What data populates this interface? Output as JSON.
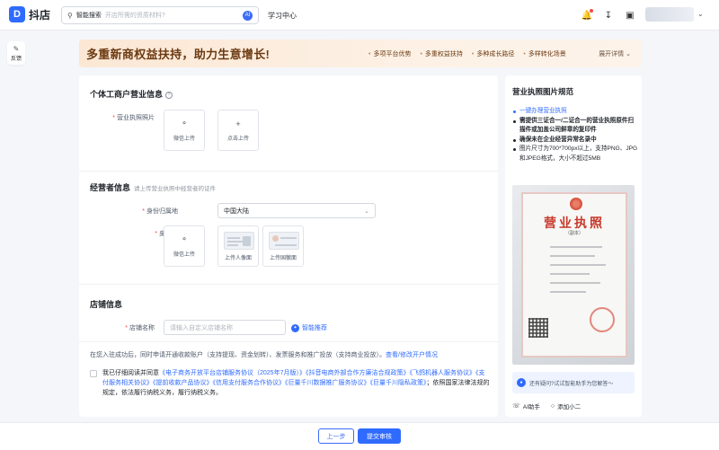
{
  "topbar": {
    "logo_text": "抖店",
    "search_label": "智能搜索",
    "search_placeholder": "开店所需的资质材料?",
    "ai_badge": "AI",
    "learning_center": "学习中心"
  },
  "feedback": {
    "label": "反馈"
  },
  "banner": {
    "title": "多重新商权益扶持，助力生意增长!",
    "tags": [
      "多项平台优势",
      "多重权益扶持",
      "多种成长路径",
      "多样转化场景"
    ],
    "expand": "展开详情"
  },
  "business_info": {
    "title": "个体工商户营业信息",
    "license_label": "营业执照照片",
    "upload_wechat": "微信上传",
    "upload_click": "点击上传"
  },
  "operator_info": {
    "title": "经营者信息",
    "subtitle": "请上传营业执照中经营者的证件",
    "id_region_label": "身份归属地",
    "id_region_value": "中国大陆",
    "id_card_label": "身份证",
    "upload_wechat": "微信上传",
    "upload_portrait": "上传人像面",
    "upload_emblem": "上传国徽面"
  },
  "store_info": {
    "title": "店铺信息",
    "store_name_label": "店铺名称",
    "store_name_placeholder": "请输入自定义店铺名称",
    "smart_recommend": "智能推荐"
  },
  "notice": {
    "text": "在您入驻成功后，同时申请开通收款账户（支持提现、资金划转）、发票服务和推广投放（支持商业投放）。",
    "link": "查看/修改开户情况"
  },
  "agreement": {
    "prefix": "我已仔细阅读并同意",
    "links": [
      "《电子商务开放平台店铺服务协议（2025年7月版）》",
      "《抖音电商外部合作方廉洁合规政策》",
      "《飞鸽机器人服务协议》",
      "《支付服务相关协议》",
      "《提前收款产品协议》",
      "《信用支付服务合作协议》",
      "《巨量千川数据推广服务协议》",
      "《巨量千川隐私政策》"
    ],
    "suffix": "；依照国家法律法规的规定，依法履行纳税义务，履行纳税义务。"
  },
  "side": {
    "title": "营业执照图片规范",
    "items": [
      {
        "text": "一键办理营业执照",
        "link": true
      },
      {
        "text": "需提供三证合一/二证合一的营业执照原件扫描件或加盖公司鲜章的复印件",
        "bold": true
      },
      {
        "text": "确保未在企业经营异常名录中",
        "bold": true
      },
      {
        "text": "图片尺寸为700*700px以上，支持PNG、JPG和JPEG格式，大小不超过5MB",
        "bold": false
      }
    ],
    "license_image_title": "营业执照",
    "license_image_sub": "（副本）",
    "assistant_text": "还有疑问?试试智能助手为您解答～",
    "ai_helper": "AI助手",
    "add_helper": "添加小二"
  },
  "footer": {
    "prev": "上一步",
    "submit": "提交审核"
  },
  "colors": {
    "primary": "#2f6bff",
    "banner_text": "#6b3a12",
    "required": "#f54a45"
  }
}
